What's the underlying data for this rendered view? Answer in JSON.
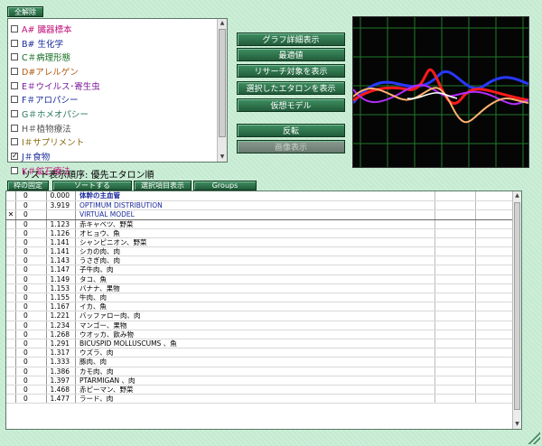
{
  "top_button": "全解除",
  "categories": [
    {
      "label": "A# 臓器標本",
      "color": "#c2127a",
      "checked": false
    },
    {
      "label": "B# 生化学",
      "color": "#1a2a9a",
      "checked": false
    },
    {
      "label": "C＃病理形態",
      "color": "#0e6a1e",
      "checked": false
    },
    {
      "label": "D#アレルゲン",
      "color": "#b05a10",
      "checked": false
    },
    {
      "label": "E＃ウイルス･寄生虫",
      "color": "#7a1a9a",
      "checked": false
    },
    {
      "label": "F＃アロパシー",
      "color": "#1a2a9a",
      "checked": false
    },
    {
      "label": "G＃ホメオパシー",
      "color": "#2a7a5a",
      "checked": false
    },
    {
      "label": "H＃植物療法",
      "color": "#555555",
      "checked": false
    },
    {
      "label": "I＃サプリメント",
      "color": "#8a6a10",
      "checked": false
    },
    {
      "label": "J＃食物",
      "color": "#1a2a9a",
      "checked": true
    },
    {
      "label": "K＃鉱石療法",
      "color": "#c2127a",
      "checked": false
    }
  ],
  "actions": {
    "graph_detail": "グラフ詳細表示",
    "optimum": "最適値",
    "show_research": "リサーチ対象を表示",
    "show_selected": "選択したエタロンを表示",
    "virtual_model": "仮想モデル",
    "invert": "反転",
    "show_image": "画像表示"
  },
  "sort_label": "リスト表示順序: 優先エタロン順",
  "toolbar": {
    "fix_column": "枠の固定",
    "sort": "ソートする",
    "show_selection": "選択項目表示",
    "groups": "Groups"
  },
  "header_rows": [
    {
      "mark": "",
      "col1": "0",
      "value": "0.000",
      "name": "体幹の主血管"
    },
    {
      "mark": "",
      "col1": "0",
      "value": "3.919",
      "name": "OPTIMUM DISTRIBUTION"
    },
    {
      "mark": "✕",
      "col1": "0",
      "value": "",
      "name": "VIRTUAL MODEL"
    }
  ],
  "rows": [
    {
      "col1": "0",
      "value": "1.123",
      "name": "赤キャベツ、野菜"
    },
    {
      "col1": "0",
      "value": "1.126",
      "name": "オヒョウ、魚"
    },
    {
      "col1": "0",
      "value": "1.141",
      "name": "シャンピニオン、野菜"
    },
    {
      "col1": "0",
      "value": "1.141",
      "name": "シカの肉、肉"
    },
    {
      "col1": "0",
      "value": "1.143",
      "name": "うさぎ肉、肉"
    },
    {
      "col1": "0",
      "value": "1.147",
      "name": "子牛肉、肉"
    },
    {
      "col1": "0",
      "value": "1.149",
      "name": "タコ、魚"
    },
    {
      "col1": "0",
      "value": "1.153",
      "name": "バナナ、果物"
    },
    {
      "col1": "0",
      "value": "1.155",
      "name": "牛肉、肉"
    },
    {
      "col1": "0",
      "value": "1.167",
      "name": "イカ、魚"
    },
    {
      "col1": "0",
      "value": "1.221",
      "name": "バッファロー肉、肉"
    },
    {
      "col1": "0",
      "value": "1.234",
      "name": "マンゴー、果物"
    },
    {
      "col1": "0",
      "value": "1.268",
      "name": "ウオッカ、飲み物"
    },
    {
      "col1": "0",
      "value": "1.291",
      "name": "BICUSPID MOLLUSCUMS 、魚"
    },
    {
      "col1": "0",
      "value": "1.317",
      "name": "ウズラ、肉"
    },
    {
      "col1": "0",
      "value": "1.333",
      "name": "豚肉、肉"
    },
    {
      "col1": "0",
      "value": "1.386",
      "name": "カモ肉、肉"
    },
    {
      "col1": "0",
      "value": "1.397",
      "name": "PTARMIGAN 、肉"
    },
    {
      "col1": "0",
      "value": "1.468",
      "name": "赤ピーマン、野菜"
    },
    {
      "col1": "0",
      "value": "1.477",
      "name": "ラード、肉"
    }
  ],
  "colors": {
    "accent_button": "#2f7a4e",
    "graph_bg": "#050505",
    "graph_grid": "#1f7a2a",
    "curve_blue": "#2838ff",
    "curve_red": "#ff1a1a",
    "curve_purple": "#b42cff",
    "curve_orange": "#ffb070",
    "curve_white": "#ffffff"
  }
}
